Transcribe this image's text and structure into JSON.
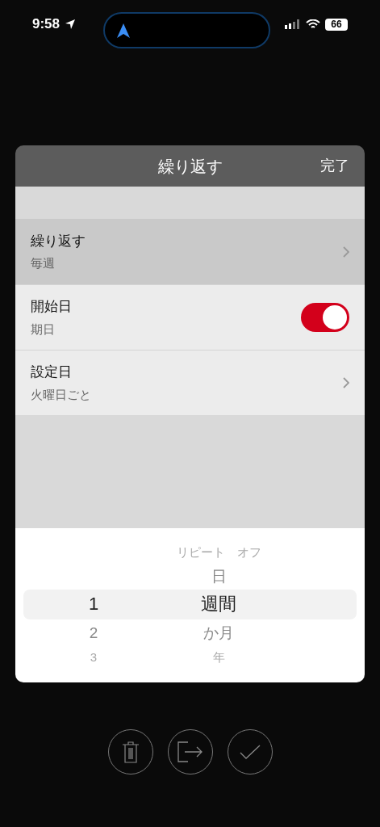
{
  "status_bar": {
    "time": "9:58",
    "battery": "66"
  },
  "dialog": {
    "title": "繰り返す",
    "done": "完了",
    "rows": [
      {
        "kind": "chevron",
        "label": "繰り返す",
        "value": "毎週",
        "selected": true
      },
      {
        "kind": "toggle",
        "label": "開始日",
        "value": "期日",
        "on": true,
        "selected": false
      },
      {
        "kind": "chevron",
        "label": "設定日",
        "value": "火曜日ごと",
        "selected": false
      }
    ],
    "picker": {
      "left": [
        {
          "label": "1",
          "selected": true
        },
        {
          "label": "2",
          "selected": false
        },
        {
          "label": "3",
          "selected": false
        }
      ],
      "right": [
        {
          "label": "リピート　オフ",
          "selected": false
        },
        {
          "label": "日",
          "selected": false
        },
        {
          "label": "週間",
          "selected": true
        },
        {
          "label": "か月",
          "selected": false
        },
        {
          "label": "年",
          "selected": false
        }
      ]
    }
  }
}
